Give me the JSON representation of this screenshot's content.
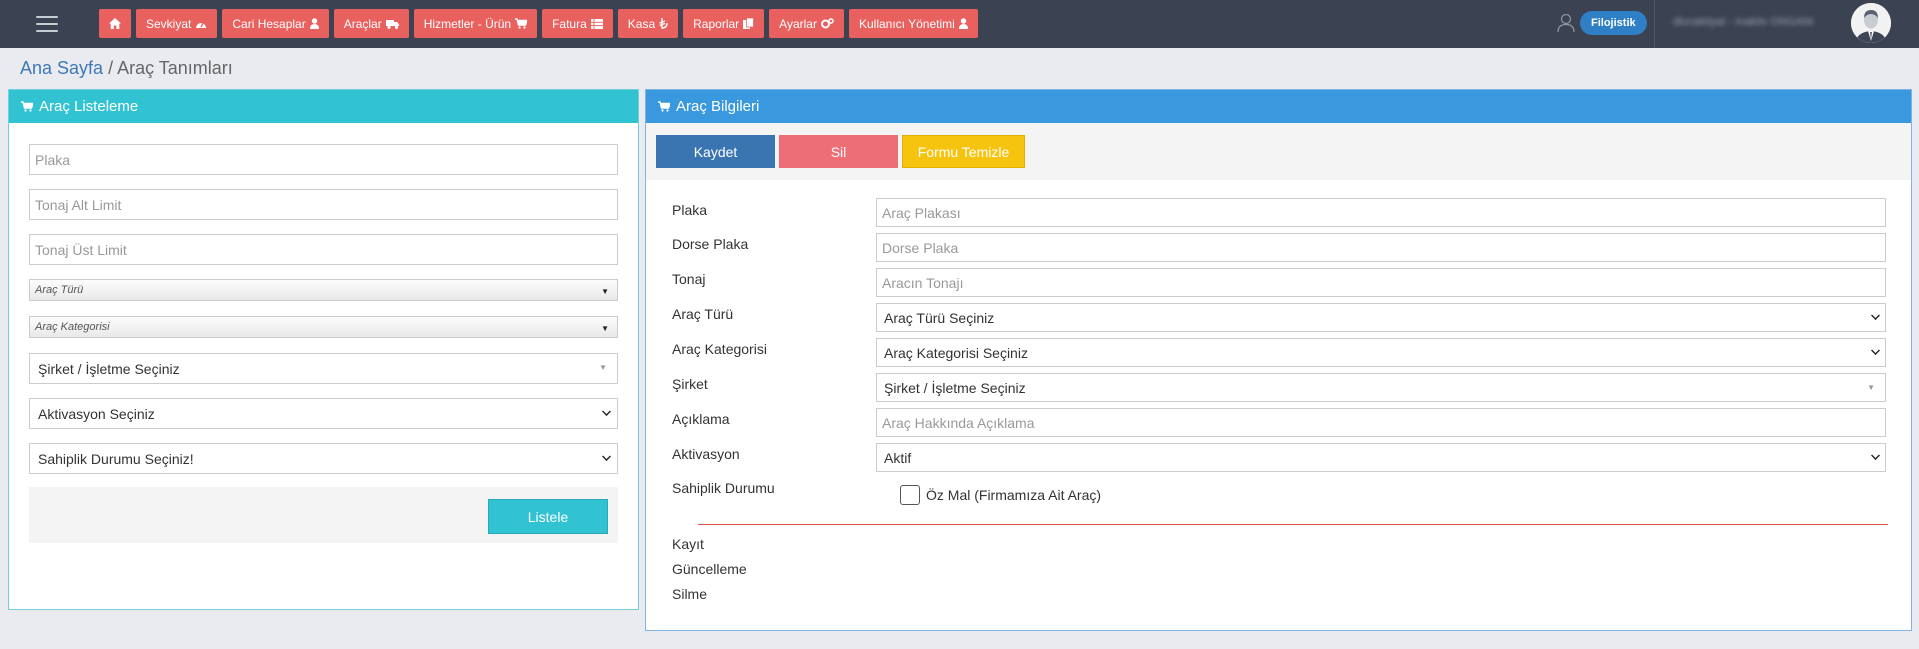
{
  "nav": {
    "items": [
      {
        "label": "",
        "icon": "home-icon"
      },
      {
        "label": "Sevkiyat",
        "icon": "dashboard-icon"
      },
      {
        "label": "Cari Hesaplar",
        "icon": "user-icon"
      },
      {
        "label": "Araçlar",
        "icon": "truck-icon"
      },
      {
        "label": "Hizmetler - Ürün",
        "icon": "cart-icon"
      },
      {
        "label": "Fatura",
        "icon": "list-icon"
      },
      {
        "label": "Kasa",
        "icon": "lira-icon"
      },
      {
        "label": "Raporlar",
        "icon": "files-icon"
      },
      {
        "label": "Ayarlar",
        "icon": "cogs-icon"
      },
      {
        "label": "Kullanıcı Yönetimi",
        "icon": "user-icon"
      }
    ],
    "company": "Filojistik",
    "username": "dlunaktiyat - Inaktiv ONGANI"
  },
  "breadcrumb": {
    "home": "Ana Sayfa",
    "separator": " / ",
    "current": "Araç Tanımları"
  },
  "left_panel": {
    "title": "Araç Listeleme",
    "plaka_placeholder": "Plaka",
    "tonaj_alt_placeholder": "Tonaj Alt Limit",
    "tonaj_ust_placeholder": "Tonaj Üst Limit",
    "arac_turu": "Araç Türü",
    "arac_kategorisi": "Araç Kategorisi",
    "sirket": "Şirket / İşletme Seçiniz",
    "aktivasyon": "Aktivasyon Seçiniz",
    "sahiplik": "Sahiplik Durumu Seçiniz!",
    "list_button": "Listele"
  },
  "right_panel": {
    "title": "Araç Bilgileri",
    "save_button": "Kaydet",
    "delete_button": "Sil",
    "clear_button": "Formu Temizle",
    "fields": {
      "plaka": {
        "label": "Plaka",
        "placeholder": "Araç Plakası"
      },
      "dorse": {
        "label": "Dorse Plaka",
        "placeholder": "Dorse Plaka"
      },
      "tonaj": {
        "label": "Tonaj",
        "placeholder": "Aracın Tonajı"
      },
      "arac_turu": {
        "label": "Araç Türü",
        "value": "Araç Türü Seçiniz"
      },
      "arac_kategorisi": {
        "label": "Araç Kategorisi",
        "value": "Araç Kategorisi Seçiniz"
      },
      "sirket": {
        "label": "Şirket",
        "value": "Şirket / İşletme Seçiniz"
      },
      "aciklama": {
        "label": "Açıklama",
        "placeholder": "Araç Hakkında Açıklama"
      },
      "aktivasyon": {
        "label": "Aktivasyon",
        "value": "Aktif"
      },
      "sahiplik": {
        "label": "Sahiplik Durumu",
        "checkbox": "Öz Mal (Firmamıza Ait Araç)"
      }
    },
    "meta": {
      "kayit": "Kayıt",
      "guncelleme": "Güncelleme",
      "silme": "Silme"
    }
  },
  "colors": {
    "navbar": "#3b4252",
    "menu_button": "#e8615f",
    "left_header": "#32c3d3",
    "right_header": "#3998de",
    "save": "#3a75b2",
    "delete": "#ee6e78",
    "clear": "#f6c40f"
  }
}
